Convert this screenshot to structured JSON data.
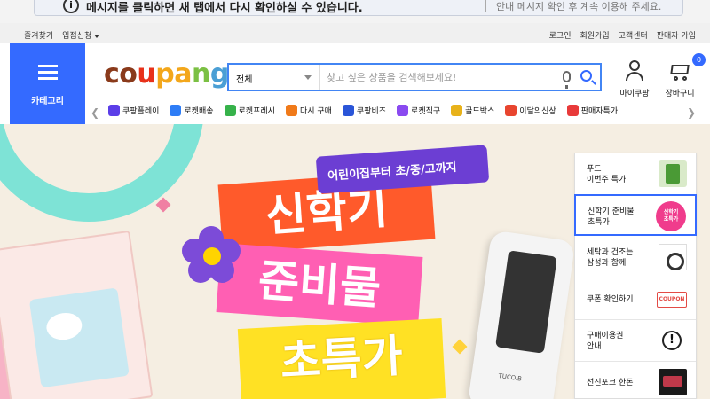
{
  "notice": {
    "text": "메시지를 클릭하면 새 탭에서 다시 확인하실 수 있습니다.",
    "sub_text": "안내 메시지 확인 후 계속 이용해 주세요."
  },
  "util_bar": {
    "left": [
      "즐겨찾기",
      "입점신청"
    ],
    "right": [
      "로그인",
      "회원가입",
      "고객센터",
      "판매자 가입"
    ]
  },
  "header": {
    "category_label": "카테고리",
    "logo": {
      "c1": "co",
      "c2": "u",
      "c3": "pa",
      "c4": "n",
      "c5": "g"
    },
    "search": {
      "category": "전체",
      "placeholder": "찾고 싶은 상품을 검색해보세요!"
    },
    "mycoupang_label": "마이쿠팡",
    "cart_label": "장바구니",
    "cart_count": "0"
  },
  "shortcuts": [
    {
      "label": "쿠팡플레이",
      "icon": "play-icon",
      "color": "#5b3ee8"
    },
    {
      "label": "로켓배송",
      "icon": "rocket-icon",
      "color": "#2e7df6"
    },
    {
      "label": "로켓프레시",
      "icon": "rocket-fresh-icon",
      "color": "#36b24a"
    },
    {
      "label": "다시 구매",
      "icon": "reorder-icon",
      "color": "#f07a1a"
    },
    {
      "label": "쿠팡비즈",
      "icon": "biz-icon",
      "color": "#2a55d8"
    },
    {
      "label": "로켓직구",
      "icon": "global-icon",
      "color": "#8a4af0"
    },
    {
      "label": "골드박스",
      "icon": "goldbox-icon",
      "color": "#e8b21a"
    },
    {
      "label": "이달의신상",
      "icon": "new-icon",
      "color": "#e8452f"
    },
    {
      "label": "판매자특가",
      "icon": "sale-icon",
      "color": "#e83a3a"
    }
  ],
  "banner": {
    "tag": "어린이집부터 초/중/고까지",
    "line1": "신학기",
    "line2": "준비물",
    "line3": "초특가",
    "product_brand": "TUCO.B"
  },
  "side_panel": [
    {
      "label": "푸드\n이번주 특가",
      "thumb": "food"
    },
    {
      "label": "신학기 준비물\n초특가",
      "thumb": "badge",
      "badge": "신학기\n초특가",
      "active": true
    },
    {
      "label": "세탁과 건조는\n삼성과 함께",
      "thumb": "washer"
    },
    {
      "label": "쿠폰 확인하기",
      "thumb": "coupon",
      "badge": "COUPON"
    },
    {
      "label": "구매이용권\n안내",
      "thumb": "excl",
      "badge": "!"
    },
    {
      "label": "선진포크 한돈",
      "thumb": "meat"
    }
  ],
  "colors": {
    "brand_blue": "#346aff",
    "banner_bg": "#f5eee2"
  }
}
